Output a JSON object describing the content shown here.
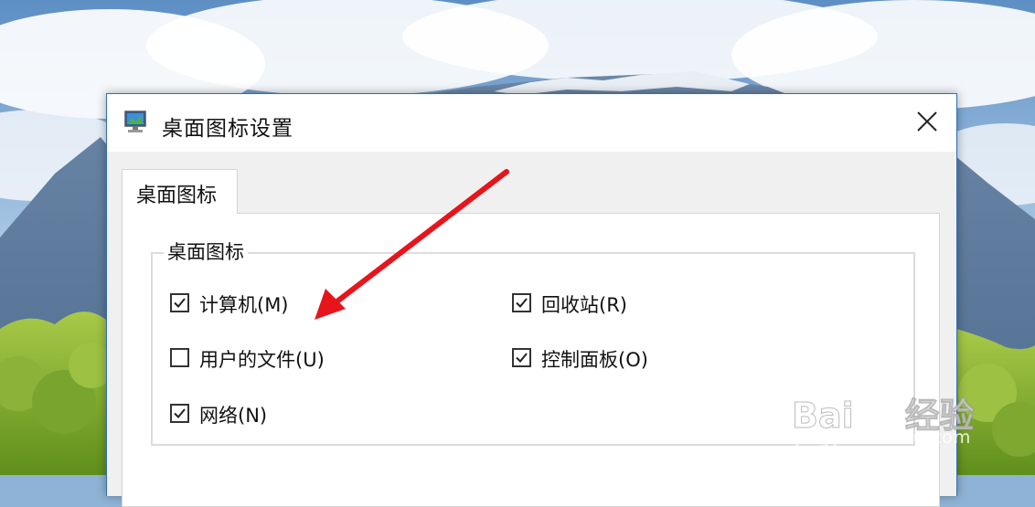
{
  "dialog": {
    "title": "桌面图标设置",
    "tab_label": "桌面图标",
    "group_label": "桌面图标",
    "checkboxes": [
      {
        "label": "计算机(M)",
        "checked": true
      },
      {
        "label": "用户的文件(U)",
        "checked": false
      },
      {
        "label": "网络(N)",
        "checked": true
      },
      {
        "label": "回收站(R)",
        "checked": true
      },
      {
        "label": "控制面板(O)",
        "checked": true
      }
    ]
  },
  "watermark": {
    "brand_prefix": "Bai",
    "brand_suffix": "经验",
    "url": "jingyan.baidu.com"
  },
  "annotation": {
    "arrow_color": "#e8141b"
  },
  "icons": [
    "app-icon",
    "close-icon",
    "checkmark-icon",
    "baidu-paw-icon"
  ]
}
